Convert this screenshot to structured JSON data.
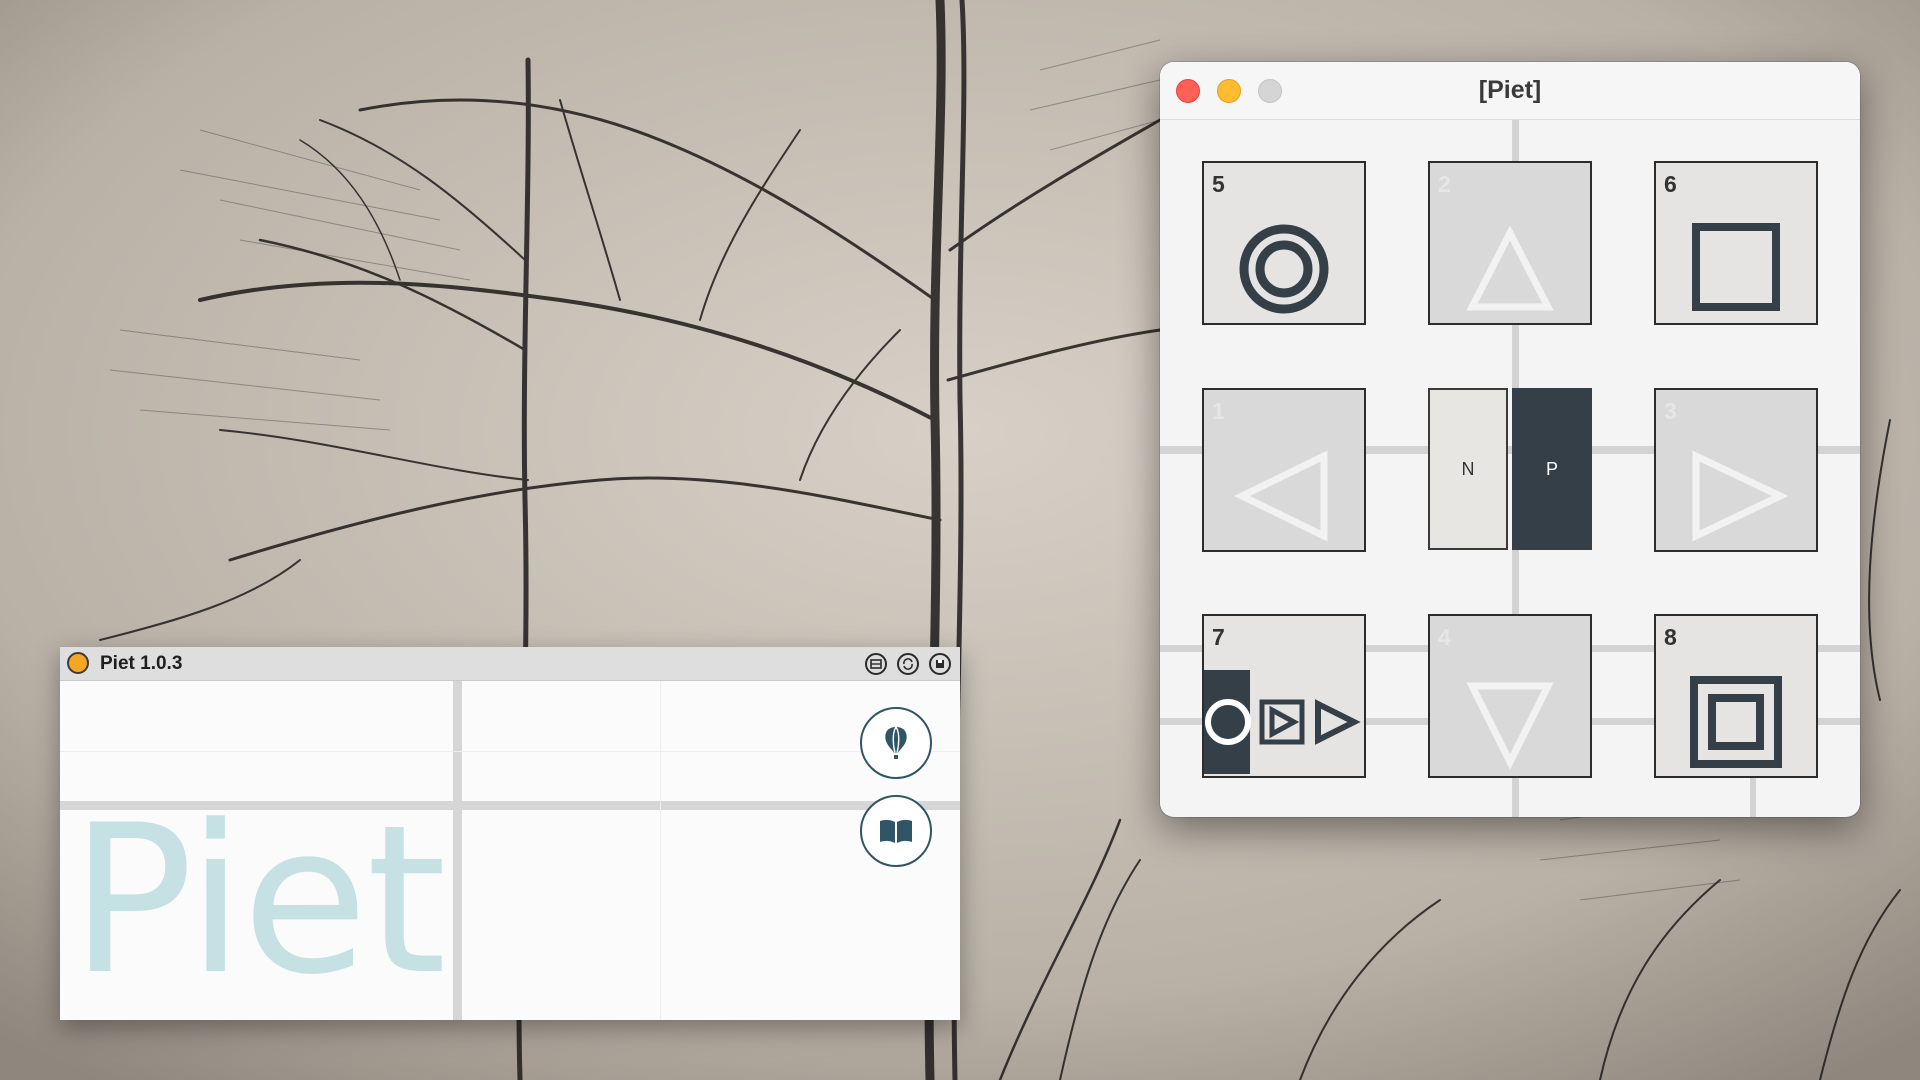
{
  "controller_window": {
    "title": "[Piet]",
    "buttons": {
      "close": "close",
      "minimize": "minimize",
      "zoom": "zoom"
    },
    "pads": [
      {
        "num": "5",
        "icon": "double-circle-icon",
        "active": true
      },
      {
        "num": "2",
        "icon": "triangle-up-icon",
        "active": false
      },
      {
        "num": "6",
        "icon": "square-icon",
        "active": true
      },
      {
        "num": "1",
        "icon": "triangle-left-icon",
        "active": false
      },
      {
        "num": "3",
        "icon": "triangle-right-icon",
        "active": false
      },
      {
        "num": "7",
        "icon": "circle-play-play-icon",
        "active": true
      },
      {
        "num": "4",
        "icon": "triangle-down-icon",
        "active": false
      },
      {
        "num": "8",
        "icon": "nested-square-icon",
        "active": true
      }
    ],
    "mode_toggle": {
      "n_label": "N",
      "p_label": "P",
      "selected": "P"
    }
  },
  "device_window": {
    "title": "Piet 1.0.3",
    "logo_text": "Piet",
    "toolbar_icons": [
      "freeze-icon",
      "refresh-icon",
      "save-icon"
    ],
    "buttons": {
      "info": "hot-air-balloon-icon",
      "manual": "open-book-icon"
    }
  },
  "colors": {
    "accent_dark": "#343f48",
    "logo_teal": "#c5e1e4",
    "device_dot": "#f5a623",
    "close": "#fe5f57",
    "minimize": "#febc2e"
  }
}
